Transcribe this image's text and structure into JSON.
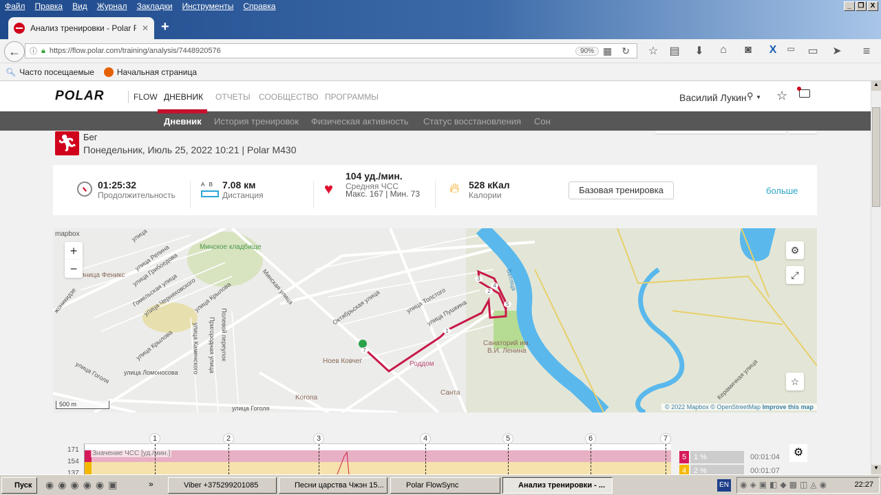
{
  "browser": {
    "menu": [
      "Файл",
      "Правка",
      "Вид",
      "Журнал",
      "Закладки",
      "Инструменты",
      "Справка"
    ],
    "tab_title": "Анализ тренировки - Polar F...",
    "url": "https://flow.polar.com/training/analysis/7448920576",
    "zoom": "90%",
    "bookmarks": [
      "Часто посещаемые",
      "Начальная страница"
    ]
  },
  "header": {
    "logo": "POLAR",
    "flow": "FLOW",
    "nav": [
      "ДНЕВНИК",
      "ОТЧЕТЫ",
      "СООБЩЕСТВО",
      "ПРОГРАММЫ"
    ],
    "user": "Василий Лукин"
  },
  "subnav": [
    "Дневник",
    "История тренировок",
    "Физическая активность",
    "Статус восстановления",
    "Сон"
  ],
  "training": {
    "sport": "Бег",
    "subtitle": "Понедельник, Июль 25, 2022 10:21 | Polar M430"
  },
  "stats": {
    "duration": "01:25:32",
    "duration_label": "Продолжительность",
    "distance": "7.08 км",
    "distance_label": "Дистанция",
    "ab": "A   B",
    "hr": "104 уд./мин.",
    "hr_label": "Средняя ЧСС",
    "hr_range": "Макс. 167 | Мин. 73",
    "calories": "528 кКал",
    "calories_label": "Калории",
    "sport_profile_button": "Базовая тренировка",
    "more_link": "больше"
  },
  "map": {
    "brand": "mapbox",
    "scale": "500 m",
    "attribution": "© 2022 Mapbox © OpenStreetMap",
    "improve": "Improve this map",
    "zoom_in": "+",
    "zoom_out": "−",
    "labels": {
      "cemetery": "Минское кладбище",
      "minskaya": "Минская улица",
      "krylova1": "улица Крылова",
      "krylova2": "улица Крылова",
      "feniks": "иница Феникс",
      "repina": "улица Репина",
      "griboedova": "улица Грибоедова",
      "gomelskaya": "Гомельская улица",
      "chernyakhovskogo": "улица Черняховского",
      "ordzhonikidze": "жоникидзе",
      "polevoy": "Полевой переулок",
      "prigorodnaya": "Пригородная улица",
      "kamenskogo": "улица Каменского",
      "lomonosova": "улица Ломоносова",
      "gogolya1": "улица Гоголя",
      "gogolya2": "улица Гоголя",
      "oktyabrskaya": "Октябрьская улица",
      "tolstogo": "улица Толстого",
      "pushkina": "улица Пушкина",
      "noev": "Ноев Ковчег",
      "roddom": "Роддом",
      "korona": "Korona",
      "santa": "Санта",
      "sanatoriy": "Санаторий им.\nВ.И. Ленина",
      "vetlitsa": "Ветлiца",
      "keramichnaya": "Керамичная улица",
      "ulitsa": "улица"
    },
    "lap_markers": [
      "1",
      "2",
      "3",
      "4",
      "5",
      "7"
    ]
  },
  "chart": {
    "laps": [
      "1",
      "2",
      "3",
      "4",
      "5",
      "6",
      "7"
    ],
    "yticks": [
      "171",
      "154",
      "137"
    ],
    "series_label": "Значение ЧСС [уд./мин.]",
    "zones": [
      {
        "zone": "5",
        "percent": "1 %",
        "time": "00:01:04",
        "color": "#d6195a"
      },
      {
        "zone": "4",
        "percent": "2 %",
        "time": "00:01:07",
        "color": "#f5b800"
      }
    ]
  },
  "taskbar": {
    "start": "Пуск",
    "tasks": [
      "Viber +375299201085",
      "Песни царства Чжэн 15...",
      "Polar FlowSync",
      "Анализ тренировки - ..."
    ],
    "lang": "EN",
    "clock": "22:27"
  }
}
